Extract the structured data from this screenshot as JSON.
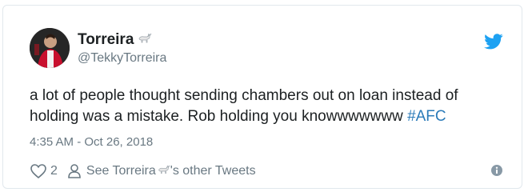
{
  "author": {
    "display_name": "Torreira",
    "handle": "@TekkyTorreira",
    "avatar_icon": "avatar-photo",
    "name_emoji_icon": "goat-emoji-icon"
  },
  "tweet": {
    "text": "a lot of people thought sending chambers out on loan instead of holding was a mistake. Rob holding you knowwwwwww ",
    "hashtag": "#AFC",
    "timestamp": "4:35 AM - Oct 26, 2018"
  },
  "actions": {
    "like_icon": "heart-icon",
    "like_count": "2",
    "profile_icon": "person-icon",
    "see_other_prefix": "See Torreira",
    "see_other_suffix": "'s other Tweets",
    "info_icon": "info-icon"
  },
  "brand": {
    "logo": "twitter-bird-icon",
    "accent_color": "#1da1f2",
    "link_color": "#2b7bb9",
    "text_color": "#1c2022",
    "muted_color": "#697882"
  }
}
